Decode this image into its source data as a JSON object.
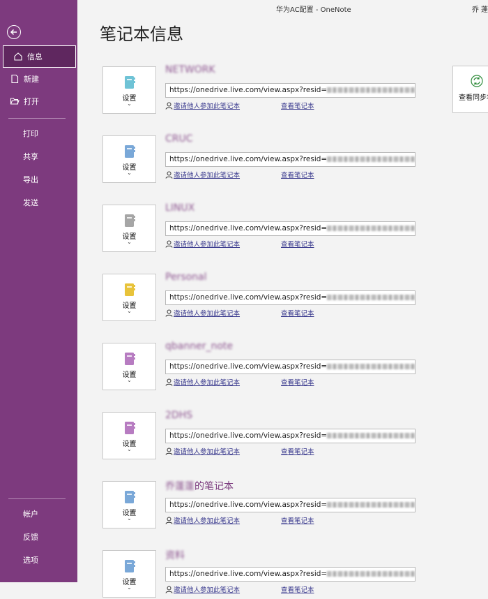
{
  "titlebar": {
    "title": "华为AC配置  -  OneNote",
    "user": "乔 蓬"
  },
  "sidebar": {
    "items": [
      {
        "label": "信息",
        "icon": "home-icon"
      },
      {
        "label": "新建",
        "icon": "new-page-icon"
      },
      {
        "label": "打开",
        "icon": "folder-open-icon"
      },
      {
        "label": "打印"
      },
      {
        "label": "共享"
      },
      {
        "label": "导出"
      },
      {
        "label": "发送"
      }
    ],
    "bottom_items": [
      {
        "label": "帐户"
      },
      {
        "label": "反馈"
      },
      {
        "label": "选项"
      }
    ]
  },
  "main": {
    "title": "笔记本信息",
    "settings_label": "设置",
    "invite_label": "邀请他人参加此笔记本",
    "view_label": "查看笔记本",
    "url_prefix": "https://onedrive.live.com/view.aspx?resid=",
    "url_suffix": "..",
    "sync_label": "查看同步状",
    "notebooks": [
      {
        "name": "NETWORK",
        "color": "#6fc3d6"
      },
      {
        "name": "CRUC",
        "color": "#7aa8d8"
      },
      {
        "name": "LINUX",
        "color": "#a6a6a6"
      },
      {
        "name": "Personal",
        "color": "#e8c33a"
      },
      {
        "name": "qbanner_note",
        "color": "#b77cc1"
      },
      {
        "name": "2DHS",
        "color": "#b77cc1"
      },
      {
        "name": "乔蓬蓬",
        "suffix": "的笔记本",
        "color": "#7aa8d8"
      },
      {
        "name": "资料",
        "color": "#7aa8d8"
      }
    ]
  }
}
